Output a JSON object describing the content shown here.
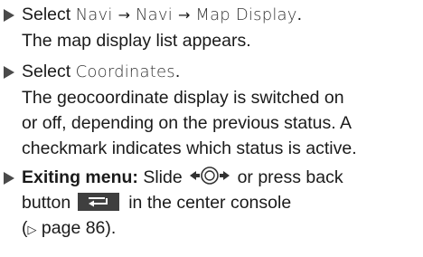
{
  "steps": [
    {
      "select_word": "Select",
      "path": [
        "Navi",
        "Navi",
        "Map Display"
      ],
      "arrow": "→",
      "period": ".",
      "result": "The map display list appears."
    },
    {
      "select_word": "Select",
      "item": "Coordinates",
      "period": ".",
      "result_line1": "The geocoordinate display is switched on",
      "result_line2": "or off, depending on the previous status. A",
      "result_line3": "checkmark indicates which status is active."
    },
    {
      "exit_label": "Exiting menu:",
      "slide_text": "Slide",
      "or_text": "or press back",
      "line2_start": "button",
      "line2_end": "in the center console",
      "page_ref_open": "(",
      "page_ref_tri": "▷",
      "page_ref_text": " page 86).",
      "slide_icon": "slide-left-right-controller-icon",
      "back_icon": "back-arrow-icon"
    }
  ],
  "colors": {
    "text": "#1a1a1a",
    "bullet": "#4a4a4a",
    "button_bg": "#3f3f3f",
    "icon_fill": "#ffffff"
  }
}
